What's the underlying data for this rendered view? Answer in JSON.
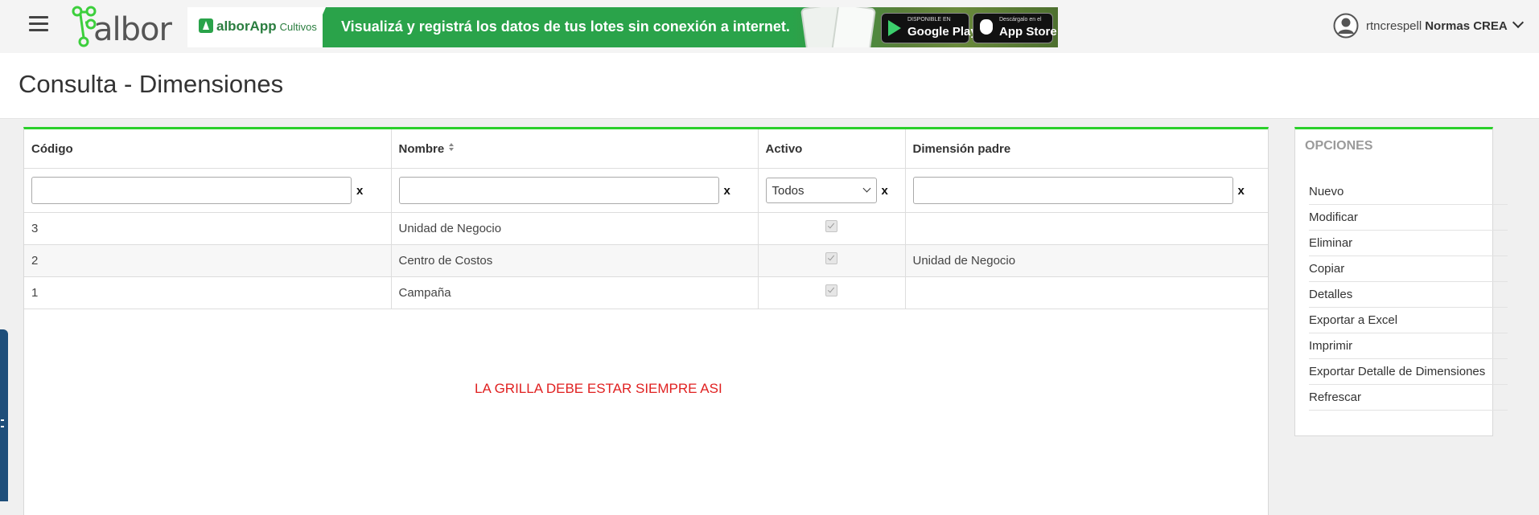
{
  "header": {
    "logo_text": "albor",
    "banner": {
      "brand": "alborApp",
      "brand_sub": "Cultivos",
      "message": "Visualizá y registrá los datos de tus lotes sin conexión a internet.",
      "google_play_small": "DISPONIBLE EN",
      "google_play": "Google Play",
      "app_store_small": "Descárgalo en el",
      "app_store": "App Store"
    },
    "user": {
      "username": "rtncrespell",
      "company": "Normas CREA"
    }
  },
  "page": {
    "title": "Consulta - Dimensiones"
  },
  "grid": {
    "columns": [
      "Código",
      "Nombre",
      "Activo",
      "Dimensión padre"
    ],
    "filter": {
      "clear_label": "x",
      "activo_selected": "Todos"
    },
    "rows": [
      {
        "codigo": "3",
        "nombre": "Unidad de Negocio",
        "activo": true,
        "padre": ""
      },
      {
        "codigo": "2",
        "nombre": "Centro de Costos",
        "activo": true,
        "padre": "Unidad de Negocio"
      },
      {
        "codigo": "1",
        "nombre": "Campaña",
        "activo": true,
        "padre": ""
      }
    ],
    "note": "LA GRILLA DEBE ESTAR SIEMPRE ASI"
  },
  "options": {
    "title": "OPCIONES",
    "items": [
      "Nuevo",
      "Modificar",
      "Eliminar",
      "Copiar",
      "Detalles",
      "Exportar a Excel",
      "Imprimir",
      "Exportar Detalle de Dimensiones",
      "Refrescar"
    ]
  },
  "colors": {
    "accent": "#2bd02b",
    "banner_green": "#2aa34a",
    "note_red": "#e02020"
  }
}
